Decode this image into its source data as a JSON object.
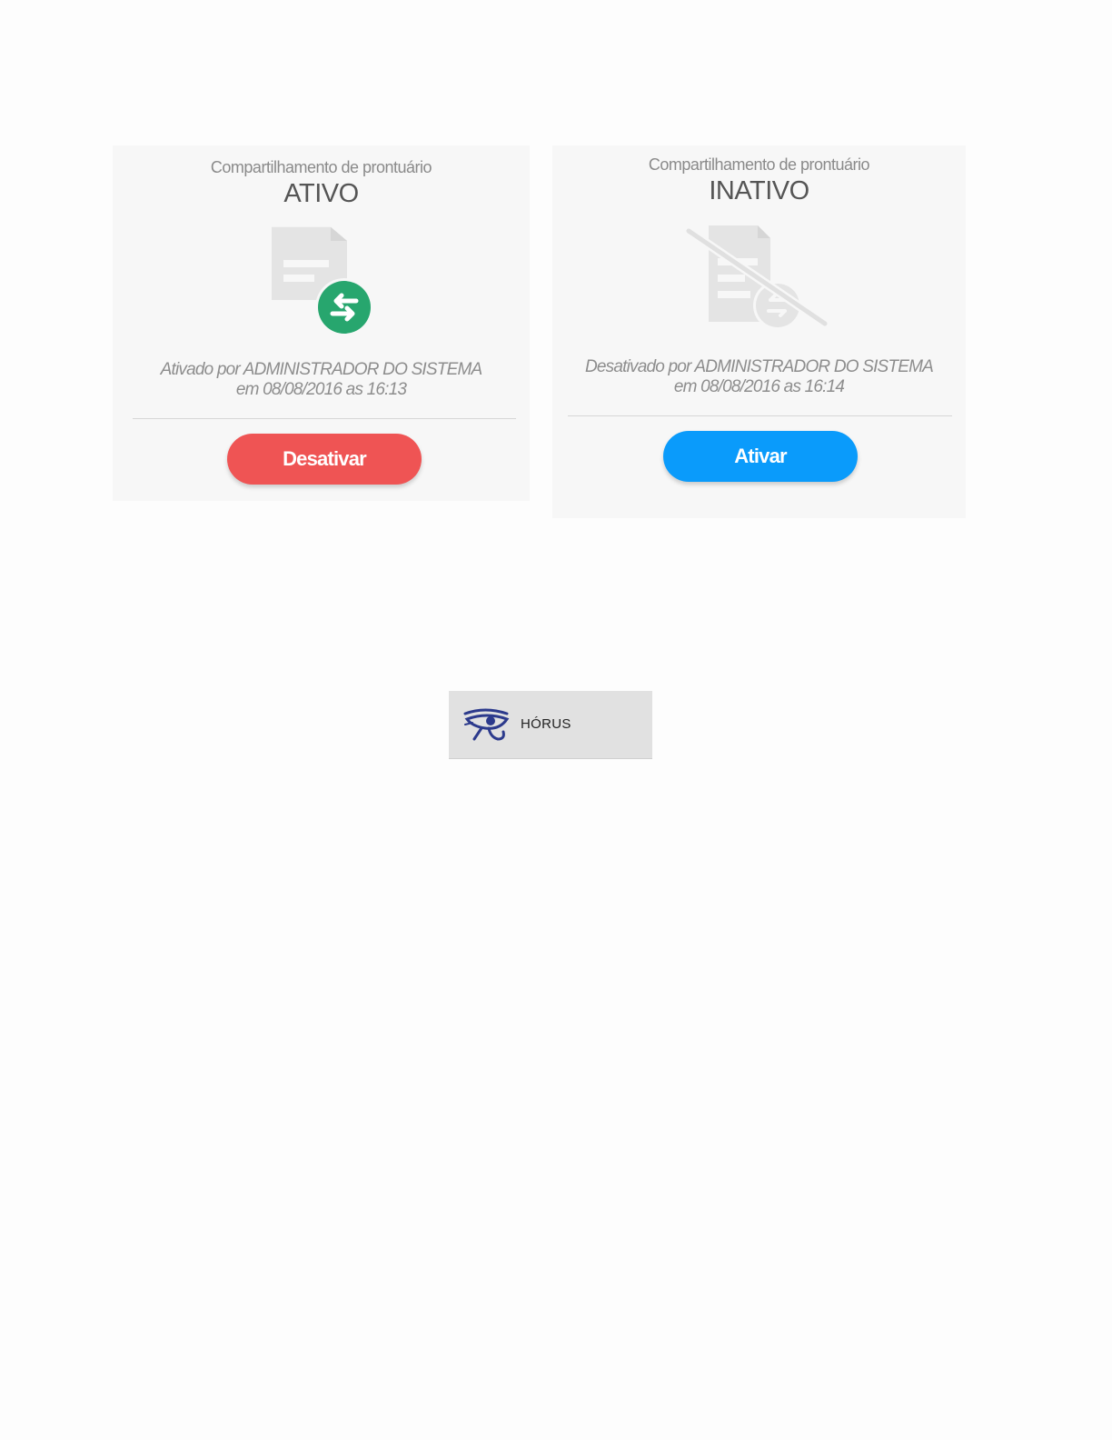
{
  "cards": {
    "active": {
      "title": "Compartilhamento de prontuário",
      "status": "ATIVO",
      "info_line1": "Ativado por ADMINISTRADOR DO SISTEMA",
      "info_line2": "em 08/08/2016 as 16:13",
      "button_label": "Desativar",
      "icon": "document-share-icon",
      "button_color": "#ef5454",
      "badge_color": "#27a66e"
    },
    "inactive": {
      "title": "Compartilhamento de prontuário",
      "status": "INATIVO",
      "info_line1": "Desativado por ADMINISTRADOR DO SISTEMA",
      "info_line2": "em 08/08/2016 as 16:14",
      "button_label": "Ativar",
      "icon": "document-share-disabled-icon",
      "button_color": "#0a9bfb"
    }
  },
  "logo": {
    "text": "HÓRUS",
    "icon": "eye-of-horus-icon",
    "color": "#2c3a8c"
  }
}
